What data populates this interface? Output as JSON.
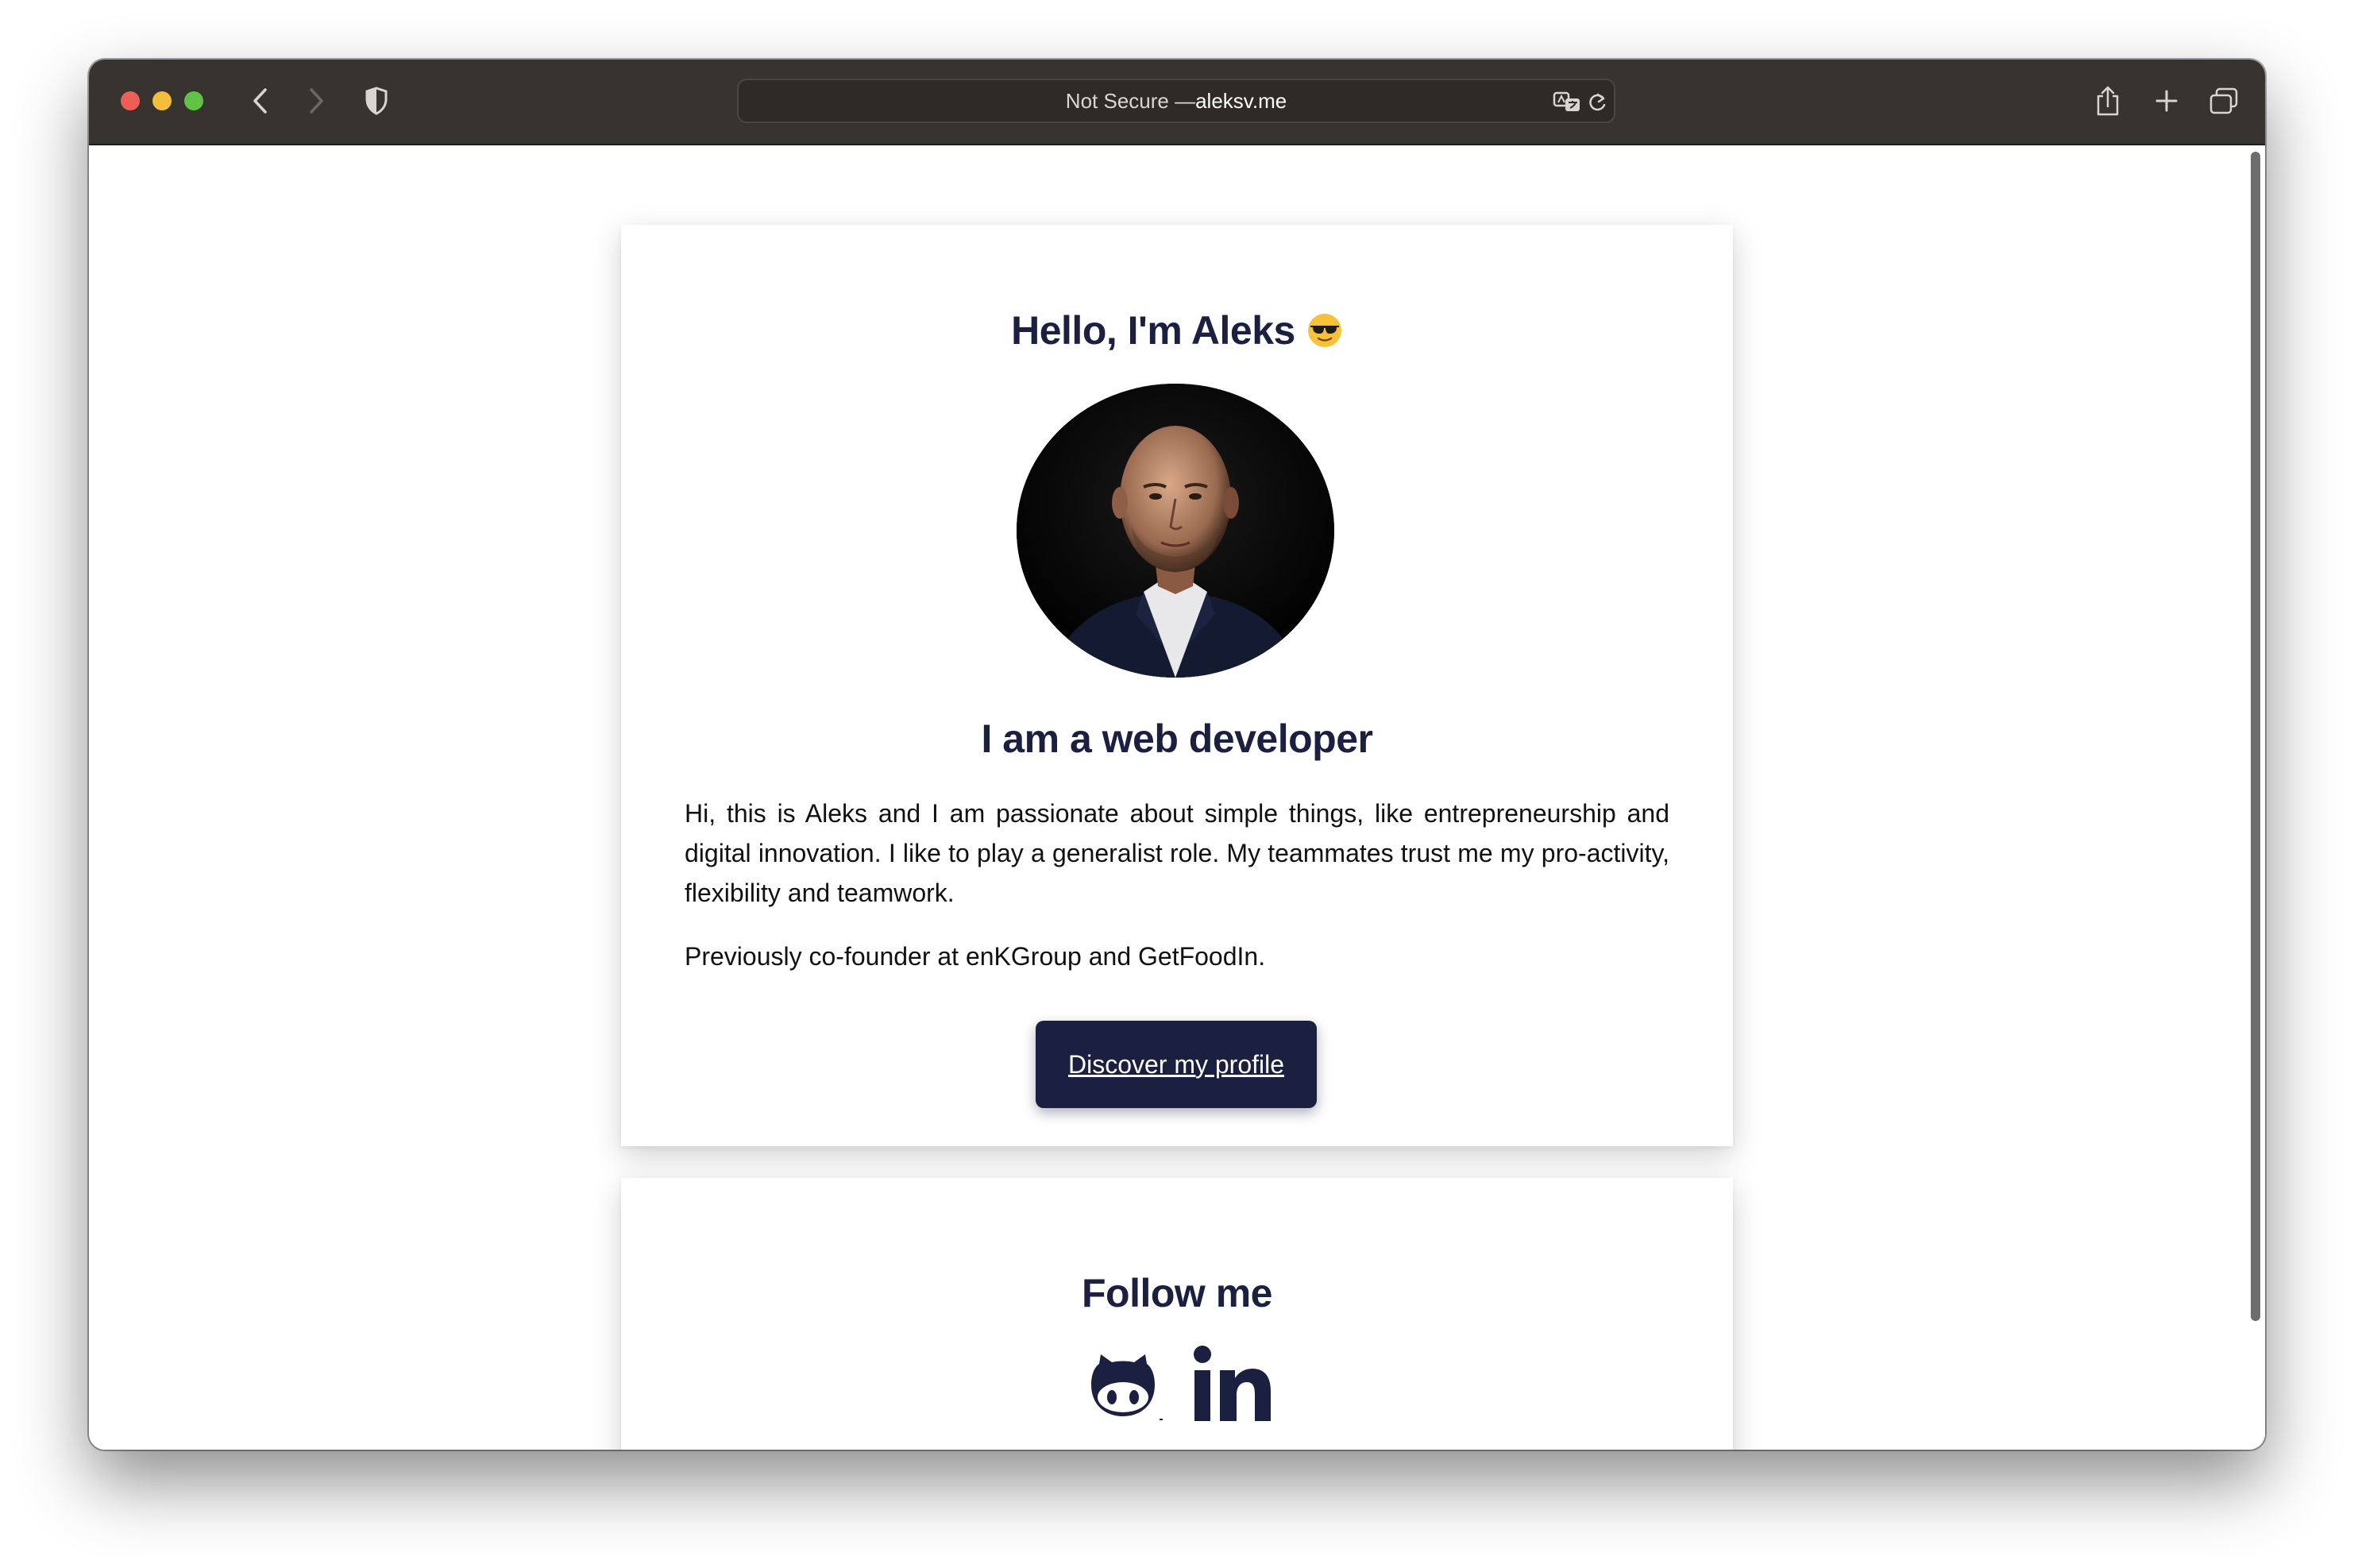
{
  "browser": {
    "url_prefix": "Not Secure — ",
    "url_host": "aleksv.me",
    "colors": {
      "toolbar": "#37332f",
      "close": "#ee5e57",
      "minimize": "#f4bd3b",
      "zoom": "#5fc445"
    }
  },
  "about": {
    "greeting": "Hello, I'm Aleks",
    "greeting_emoji": "sunglasses-face-emoji",
    "role": "I am a web developer",
    "bio": "Hi, this is Aleks and I am passionate about simple things, like entrepreneurship and digital innovation. I like to play a generalist role. My teammates trust me my pro-activity, flexibility and teamwork.",
    "previously": "Previously co-founder at enKGroup and GetFoodIn.",
    "cta_label": "Discover my profile"
  },
  "follow": {
    "title": "Follow me",
    "links": [
      {
        "icon": "github-icon"
      },
      {
        "icon": "linkedin-icon"
      }
    ]
  },
  "theme": {
    "accent": "#1b2040",
    "text": "#111111",
    "background": "#ffffff"
  }
}
